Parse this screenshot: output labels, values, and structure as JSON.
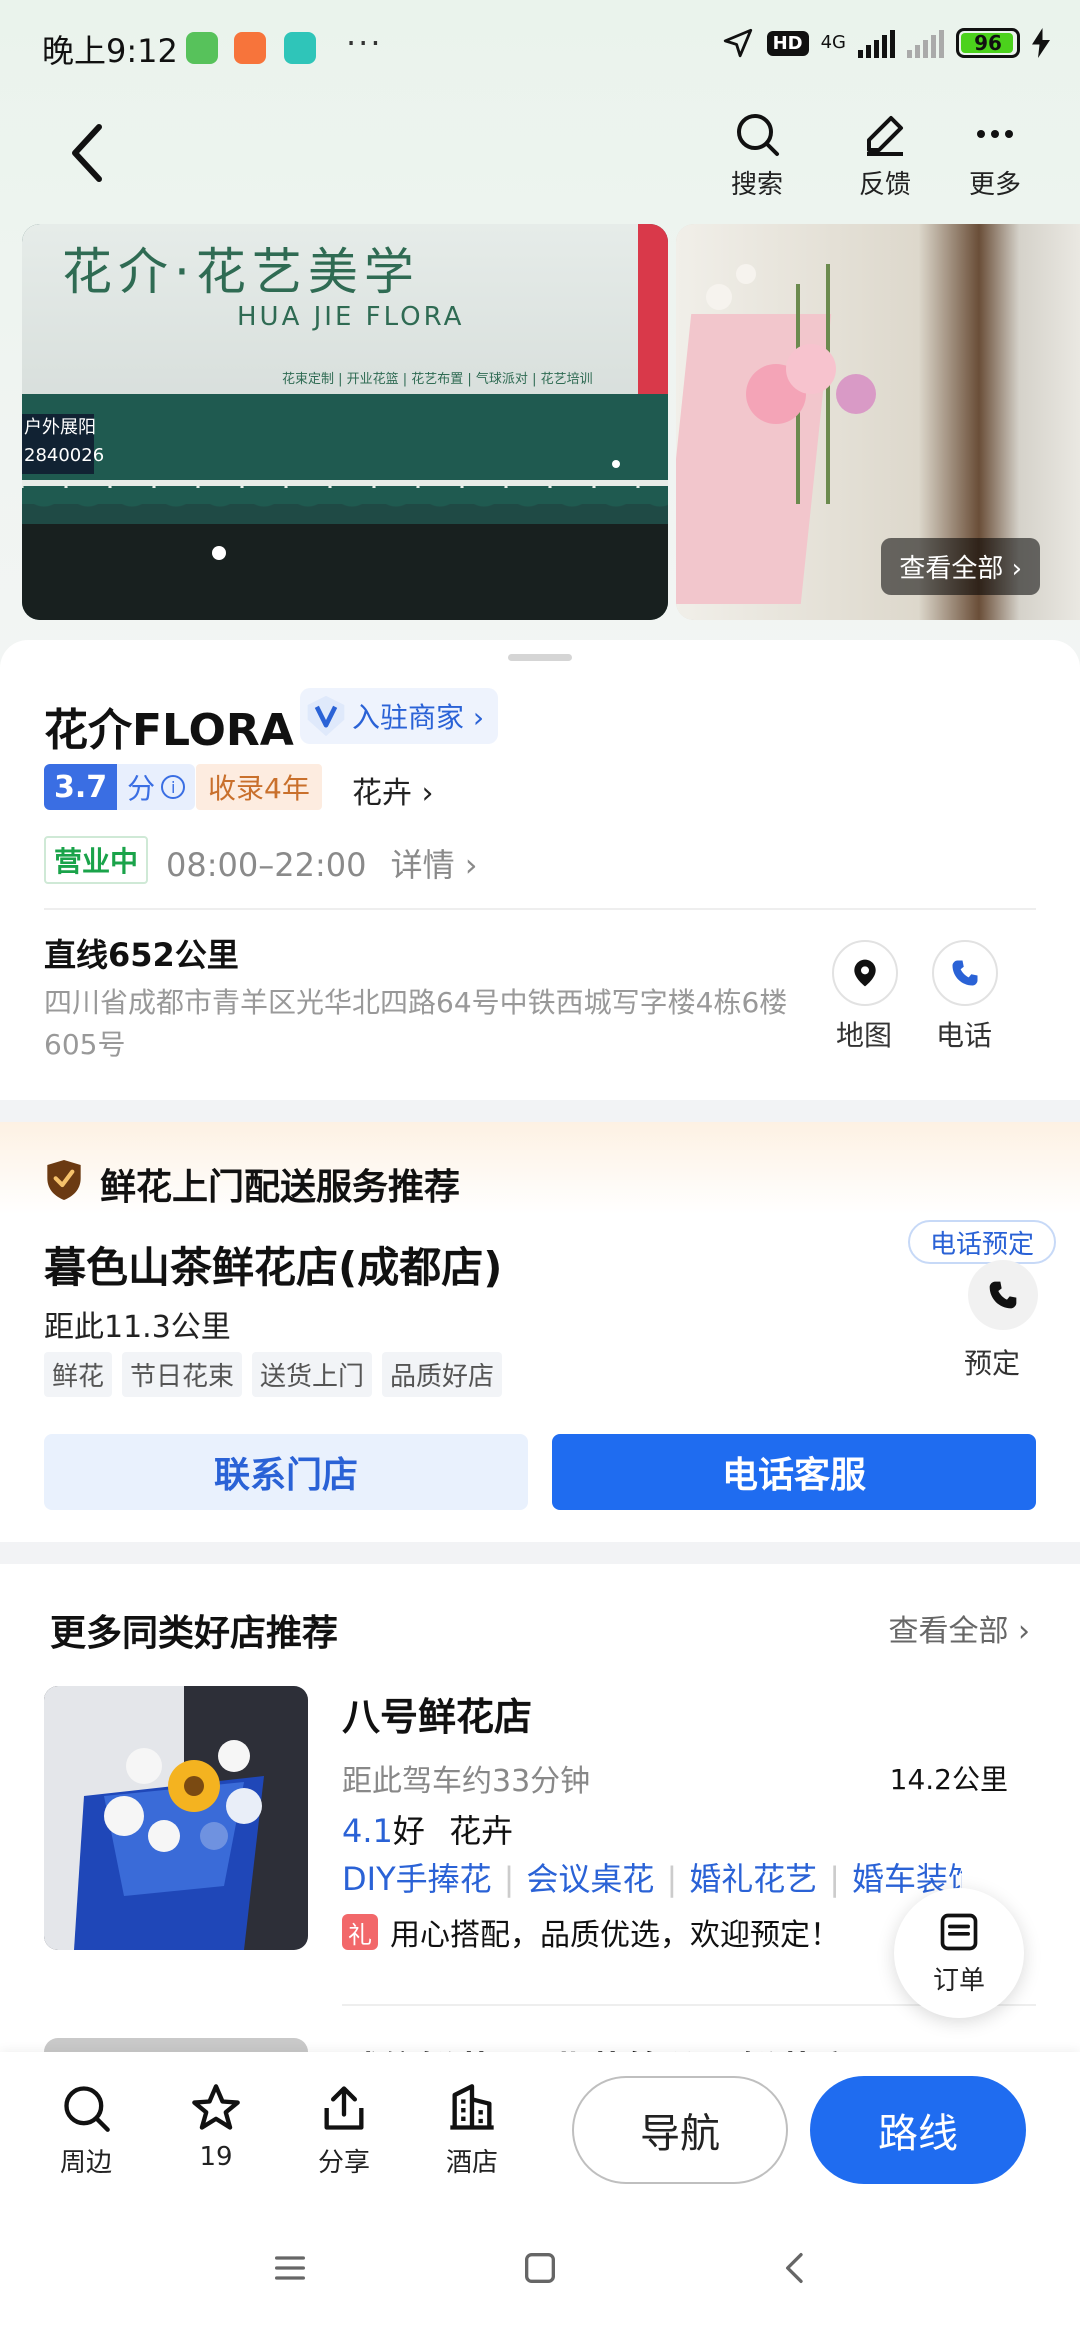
{
  "status_bar": {
    "time": "晚上9:12",
    "more": "···",
    "hd": "HD",
    "network": "4G",
    "battery": "96",
    "battery_level": 0.96
  },
  "header": {
    "search_label": "搜索",
    "feedback_label": "反馈",
    "more_label": "更多"
  },
  "gallery": {
    "sign_cn": "花介·花艺美学",
    "sign_en": "HUA JIE FLORA",
    "sign_services": "花束定制 | 开业花篮 | 花艺布置 | 气球派对 | 花艺培训",
    "sign_phone": "户外展阳\n2840026",
    "see_all": "查看全部 ›"
  },
  "shop": {
    "name": "花介FLORA",
    "verified_label": "入驻商家 ›",
    "rating": "3.7",
    "rating_unit": "分",
    "years": "收录4年",
    "category": "花卉 ›",
    "open_status": "营业中",
    "hours": "08:00–22:00",
    "hours_detail": "详情 ›",
    "distance": "直线652公里",
    "address": "四川省成都市青羊区光华北四路64号中铁西城写字楼4栋6楼605号",
    "map_label": "地图",
    "phone_label": "电话"
  },
  "delivery": {
    "title": "鲜花上门配送服务推荐",
    "store_name": "暮色山茶鲜花店(成都店)",
    "store_distance": "距此11.3公里",
    "tags": [
      "鲜花",
      "节日花束",
      "送货上门",
      "品质好店"
    ],
    "reserve_pill": "电话预定",
    "reserve_label": "预定",
    "contact_button": "联系门店",
    "phone_button": "电话客服"
  },
  "recommend": {
    "title": "更多同类好店推荐",
    "see_all": "查看全部 ›",
    "item1": {
      "name": "八号鲜花店",
      "drive_time": "距此驾车约33分钟",
      "distance": "14.2公里",
      "score": "4.1",
      "score_word": "好",
      "category": "花卉",
      "tags": [
        "DIY手捧花",
        "会议桌花",
        "婚礼花艺",
        "婚车装饰"
      ],
      "gift_badge": "礼",
      "promo": "用心搭配，品质优选，欢迎预定！"
    },
    "item2": {
      "name": "诚信鲜花(工业花第分子鲜花店)"
    }
  },
  "order_fab": {
    "label": "订单"
  },
  "bottom_bar": {
    "nearby": "周边",
    "favorites_count": "19",
    "share": "分享",
    "hotel": "酒店",
    "navigate": "导航",
    "route": "路线"
  },
  "colors": {
    "primary_blue": "#1f6cf0",
    "open_green": "#1aa34a",
    "years_orange": "#c9702c",
    "gift_red": "#f2686a"
  }
}
